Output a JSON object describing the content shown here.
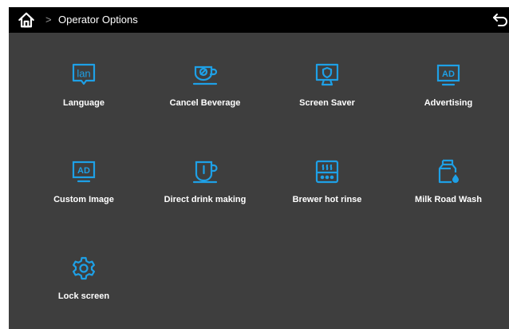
{
  "header": {
    "home_icon": "home-icon",
    "breadcrumb_separator": ">",
    "title": "Operator Options",
    "back_icon": "return-arrow-icon"
  },
  "colors": {
    "accent": "#1ea0e6",
    "background": "#3e3e3e",
    "topbar": "#000000",
    "label": "#ffffff"
  },
  "options": [
    {
      "label": "Language",
      "icon": "language-icon",
      "icon_text": "lan"
    },
    {
      "label": "Cancel Beverage",
      "icon": "cancel-beverage-cup-icon"
    },
    {
      "label": "Screen Saver",
      "icon": "screen-saver-monitor-icon"
    },
    {
      "label": "Advertising",
      "icon": "advertising-monitor-icon",
      "icon_text": "AD"
    },
    {
      "label": "Custom Image",
      "icon": "custom-image-monitor-icon",
      "icon_text": "AD"
    },
    {
      "label": "Direct drink making",
      "icon": "direct-drink-cup-icon"
    },
    {
      "label": "Brewer hot rinse",
      "icon": "brewer-hot-rinse-icon"
    },
    {
      "label": "Milk Road Wash",
      "icon": "milk-carton-wash-icon"
    },
    {
      "label": "Lock screen",
      "icon": "lock-screen-gear-icon"
    }
  ]
}
